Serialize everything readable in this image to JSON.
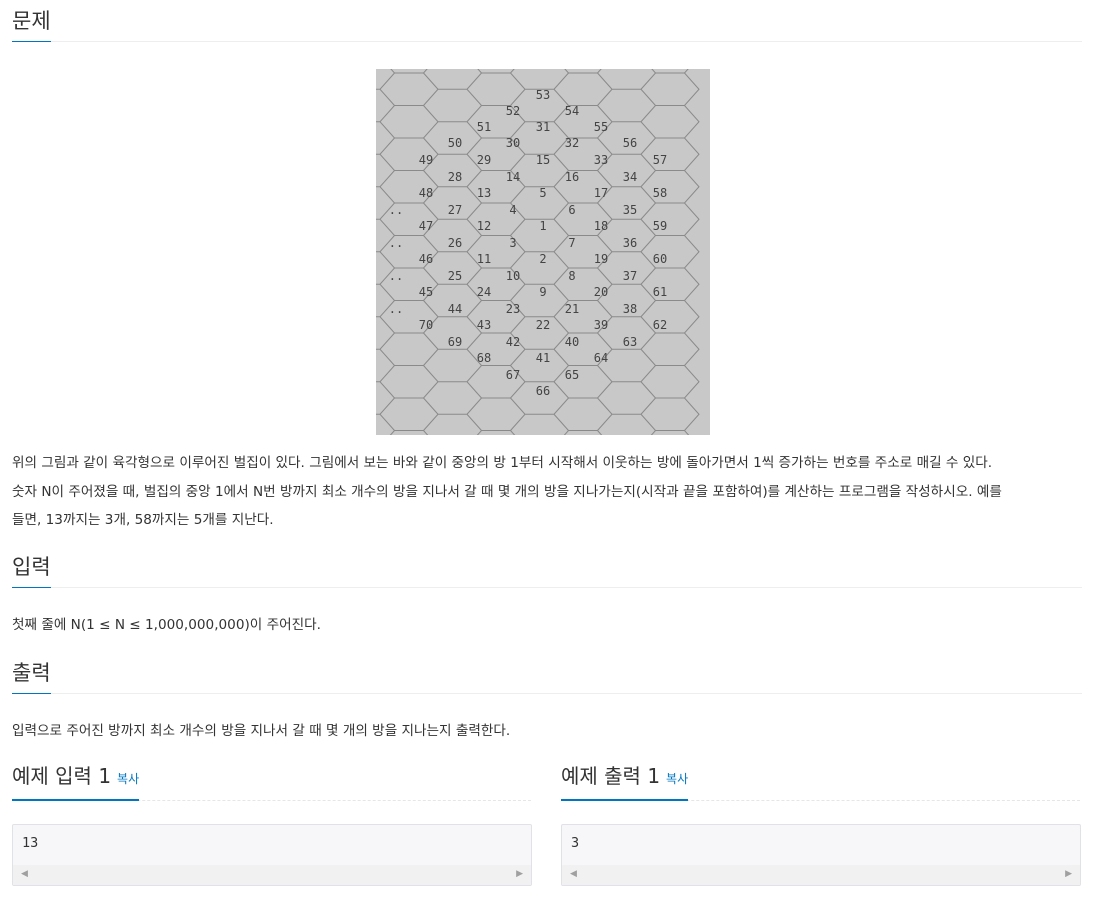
{
  "sections": {
    "problem": {
      "title": "문제"
    },
    "input": {
      "title": "입력"
    },
    "output": {
      "title": "출력"
    }
  },
  "problem_text": {
    "line1": "위의 그림과 같이 육각형으로 이루어진 벌집이 있다. 그림에서 보는 바와 같이 중앙의 방 1부터 시작해서 이웃하는 방에 돌아가면서 1씩 증가하는 번호를 주소로 매길 수 있다.",
    "line2": "숫자 N이 주어졌을 때, 벌집의 중앙 1에서 N번 방까지 최소 개수의 방을 지나서 갈 때 몇 개의 방을 지나가는지(시작과 끝을 포함하여)를 계산하는 프로그램을 작성하시오. 예를",
    "line3": "들면, 13까지는 3개, 58까지는 5개를 지난다."
  },
  "input_text": "첫째 줄에 N(1 ≤ N ≤ 1,000,000,000)이 주어진다.",
  "output_text": "입력으로 주어진 방까지 최소 개수의 방을 지나서 갈 때 몇 개의 방을 지나는지 출력한다.",
  "figure": {
    "cell_labels": [
      "53",
      "52",
      "54",
      "51",
      "31",
      "55",
      "50",
      "30",
      "32",
      "56",
      "49",
      "29",
      "15",
      "33",
      "57",
      "28",
      "14",
      "16",
      "34",
      "48",
      "13",
      "5",
      "17",
      "58",
      "..",
      "27",
      "4",
      "6",
      "35",
      "47",
      "12",
      "1",
      "18",
      "59",
      "..",
      "26",
      "3",
      "7",
      "36",
      "46",
      "11",
      "2",
      "19",
      "60",
      "..",
      "25",
      "10",
      "8",
      "37",
      "45",
      "24",
      "9",
      "20",
      "61",
      "..",
      "44",
      "23",
      "21",
      "38",
      "70",
      "43",
      "22",
      "39",
      "62",
      "69",
      "42",
      "40",
      "63",
      "68",
      "41",
      "64",
      "67",
      "65",
      "66"
    ]
  },
  "samples": {
    "input": {
      "title": "예제 입력 1",
      "copy": "복사",
      "value": "13"
    },
    "output": {
      "title": "예제 출력 1",
      "copy": "복사",
      "value": "3"
    }
  },
  "icons": {
    "scroll_left": "triangle-left",
    "scroll_right": "triangle-right"
  }
}
